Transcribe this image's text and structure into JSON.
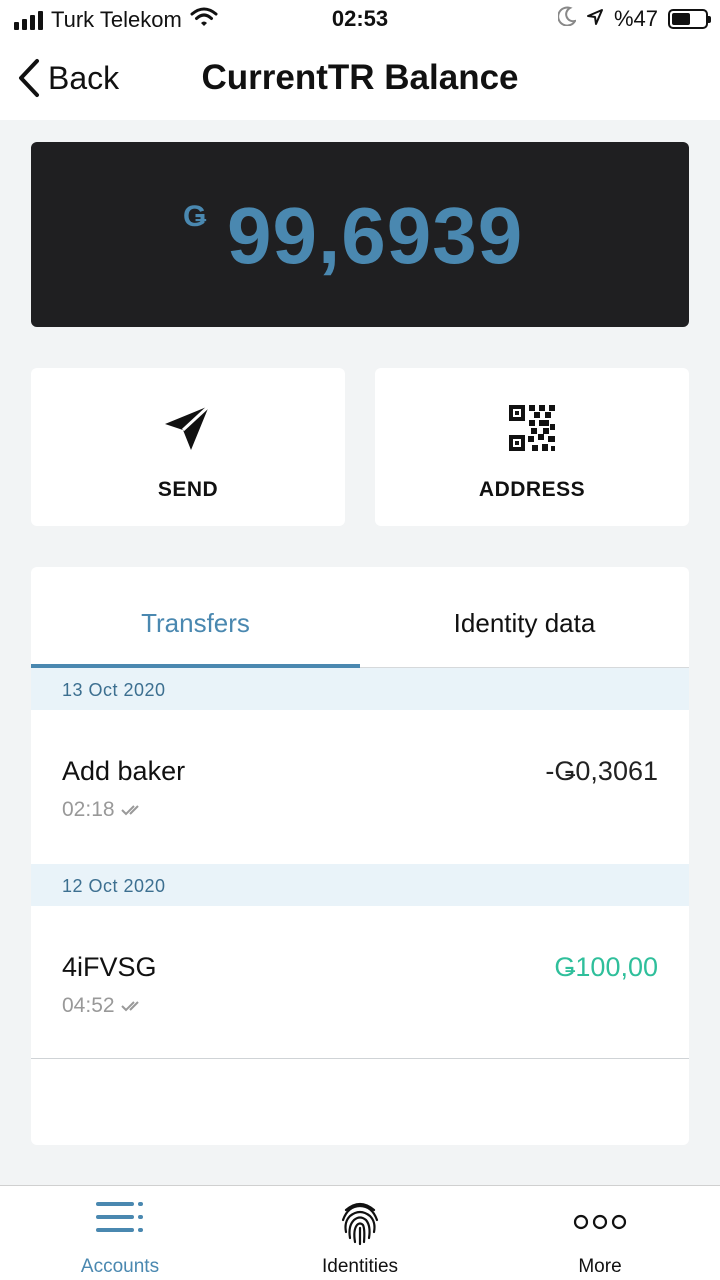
{
  "status_bar": {
    "carrier": "Turk Telekom",
    "time": "02:53",
    "battery": "%47",
    "icons": [
      "signal-icon",
      "wifi-icon",
      "moon-icon",
      "location-icon",
      "battery-icon"
    ]
  },
  "header": {
    "back_label": "Back",
    "title": "CurrentTR Balance"
  },
  "balance": {
    "currency_symbol": "Ǥ",
    "amount": "99,6939"
  },
  "actions": {
    "send_label": "SEND",
    "address_label": "ADDRESS"
  },
  "tabs": [
    {
      "label": "Transfers",
      "active": true
    },
    {
      "label": "Identity data",
      "active": false
    }
  ],
  "transactions": [
    {
      "date": "13 Oct 2020",
      "name": "Add baker",
      "time": "02:18",
      "amount": "-Ǥ0,3061"
    },
    {
      "date": "12 Oct 2020",
      "name": "4iFVSG",
      "time": "04:52",
      "amount": "Ǥ100,00"
    }
  ],
  "bottom_nav": [
    {
      "label": "Accounts",
      "icon": "menu-lines-icon",
      "active": true
    },
    {
      "label": "Identities",
      "icon": "fingerprint-icon",
      "active": false
    },
    {
      "label": "More",
      "icon": "more-dots-icon",
      "active": false
    }
  ],
  "colors": {
    "accent": "#4a88b0",
    "positive": "#2fbf9b",
    "card_dark": "#1f1f21",
    "date_band": "#e9f3f9"
  }
}
